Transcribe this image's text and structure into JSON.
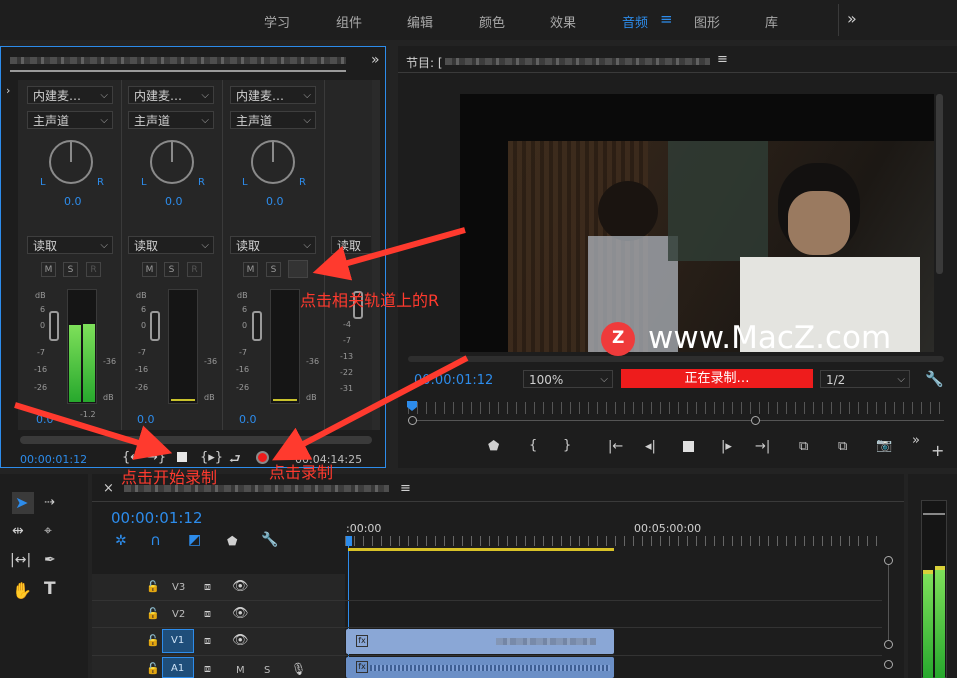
{
  "workspace": {
    "tabs": [
      "学习",
      "组件",
      "编辑",
      "颜色",
      "效果",
      "音频",
      "图形",
      "库"
    ],
    "active_tab": "音频",
    "menu_icon": "≡",
    "more_icon": "»"
  },
  "mixer": {
    "more_icon": "»",
    "channels": [
      {
        "input": "内建麦…",
        "bus": "主声道",
        "pan_value": "0.0",
        "mode": "读取",
        "m": "M",
        "s": "S",
        "r": "R",
        "l": "L",
        "rr": "R",
        "level": "0.0",
        "meter_peak": "-1.2"
      },
      {
        "input": "内建麦…",
        "bus": "主声道",
        "pan_value": "0.0",
        "mode": "读取",
        "m": "M",
        "s": "S",
        "r": "R",
        "l": "L",
        "rr": "R",
        "level": "0.0",
        "meter_peak": ""
      },
      {
        "input": "内建麦…",
        "bus": "主声道",
        "pan_value": "0.0",
        "mode": "读取",
        "m": "M",
        "s": "S",
        "r": "",
        "l": "L",
        "rr": "R",
        "level": "0.0",
        "meter_peak": ""
      }
    ],
    "master_mode": "读取",
    "db_label": "dB",
    "scale": [
      "6",
      "0",
      "-7",
      "-16",
      "-26"
    ],
    "meter_mark": "-36",
    "master_scale": [
      "-4",
      "-7",
      "-13",
      "-22",
      "-31"
    ],
    "timecode": "00:00:01:12",
    "duration": "00:04:14:25"
  },
  "program": {
    "title_prefix": "节目: [",
    "menu_icon": "≡",
    "watermark": "www.MacZ.com",
    "timecode": "00:00:01:12",
    "zoom": "100%",
    "recording_status": "正在录制…",
    "resolution": "1/2"
  },
  "annotations": {
    "click_r": "点击相关轨道上的R",
    "click_start": "点击开始录制",
    "click_record": "点击录制"
  },
  "timeline": {
    "close_icon": "×",
    "menu_icon": "≡",
    "timecode": "00:00:01:12",
    "ruler_start": ":00:00",
    "ruler_mid": "00:05:00:00",
    "tracks": [
      {
        "id": "V3",
        "target": ""
      },
      {
        "id": "V2",
        "target": ""
      },
      {
        "id": "V1",
        "target": "V1"
      },
      {
        "id": "A1",
        "target": "A1"
      }
    ],
    "audio_m": "M",
    "audio_s": "S"
  },
  "colors": {
    "accent": "#2d8ceb",
    "record_red": "#ee1c1c",
    "annotation_red": "#ff3a2e",
    "meter_green": "#3fcf3f"
  }
}
